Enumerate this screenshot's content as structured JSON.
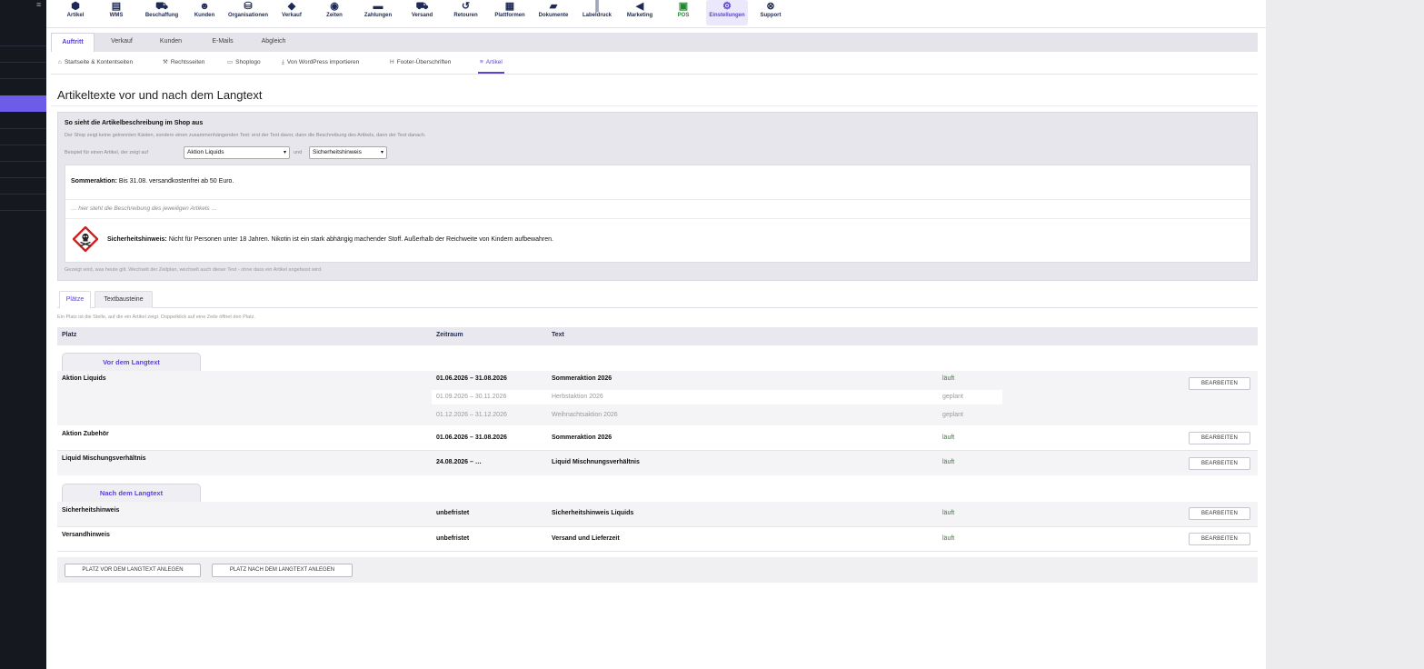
{
  "nav": [
    {
      "label": "Artikel",
      "icon": "cube-icon",
      "glyph": "⬢"
    },
    {
      "label": "WMS",
      "icon": "warehouse-icon",
      "glyph": "▤"
    },
    {
      "label": "Beschaffung",
      "icon": "cart-icon",
      "glyph": "⛟"
    },
    {
      "label": "Kunden",
      "icon": "users-icon",
      "glyph": "☻"
    },
    {
      "label": "Organisationen",
      "icon": "sitemap-icon",
      "glyph": "⛁"
    },
    {
      "label": "Verkauf",
      "icon": "tag-icon",
      "glyph": "◆"
    },
    {
      "label": "Zeiten",
      "icon": "stopwatch-icon",
      "glyph": "◉"
    },
    {
      "label": "Zahlungen",
      "icon": "money-icon",
      "glyph": "▬"
    },
    {
      "label": "Versand",
      "icon": "truck-icon",
      "glyph": "⛟"
    },
    {
      "label": "Retouren",
      "icon": "undo-icon",
      "glyph": "↺"
    },
    {
      "label": "Plattformen",
      "icon": "grid-icon",
      "glyph": "▦"
    },
    {
      "label": "Dokumente",
      "icon": "folder-icon",
      "glyph": "▰"
    },
    {
      "label": "Labeldruck",
      "icon": "barcode-icon",
      "glyph": "║"
    },
    {
      "label": "Marketing",
      "icon": "bullhorn-icon",
      "glyph": "◀"
    },
    {
      "label": "POS",
      "icon": "cash-register-icon",
      "glyph": "▣"
    },
    {
      "label": "Einstellungen",
      "icon": "gear-icon",
      "glyph": "⚙"
    },
    {
      "label": "Support",
      "icon": "lifebuoy-icon",
      "glyph": "⊗"
    }
  ],
  "tabs": [
    "Auftritt",
    "Verkauf",
    "Kunden",
    "E-Mails",
    "Abgleich"
  ],
  "subnav": [
    {
      "label": "Startseite & Kontentseiten",
      "glyph": "⌂",
      "icon": "home-icon"
    },
    {
      "label": "Rechtsseiten",
      "glyph": "⚒",
      "icon": "gavel-icon"
    },
    {
      "label": "Shoplogo",
      "glyph": "▭",
      "icon": "image-icon"
    },
    {
      "label": "Von WordPress importieren",
      "glyph": "⤓",
      "icon": "download-icon"
    },
    {
      "label": "Footer-Überschriften",
      "glyph": "H",
      "icon": "heading-icon"
    },
    {
      "label": "Artikel",
      "glyph": "≡",
      "icon": "list-icon"
    }
  ],
  "page_title": "Artikeltexte vor und nach dem Langtext",
  "preview": {
    "heading": "So sieht die Artikelbeschreibung im Shop aus",
    "description": "Der Shop zeigt keine getrennten Kästen, sondern einen zusammenhängenden Text: erst der Text davor, dann die Beschreibung des Artikels, dann der Text danach.",
    "example_label": "Beispiel für einen Artikel, der zeigt auf",
    "select1": "Aktion Liquids",
    "und": "und",
    "select2": "Sicherheitshinweis",
    "line1_bold": "Sommeraktion:",
    "line1_text": " Bis 31.08. versandkostenfrei ab 50 Euro.",
    "line2": "… hier steht die Beschreibung des jeweiligen Artikels …",
    "line3_bold": "Sicherheitshinweis:",
    "line3_text": " Nicht für Personen unter 18 Jahren. Nikotin ist ein stark abhängig machender Stoff. Außerhalb der Reichweite von Kindern aufbewahren.",
    "note": "Gezeigt wird, was heute gilt. Wechselt der Zeitplan, wechselt auch dieser Text - ohne dass ein Artikel angefasst wird."
  },
  "tabs2": [
    "Plätze",
    "Textbausteine"
  ],
  "hint": "Ein Platz ist die Stelle, auf die ein Artikel zeigt. Doppelklick auf eine Zeile öffnet den Platz.",
  "table": {
    "headers": {
      "platz": "Platz",
      "zeitraum": "Zeitraum",
      "text": "Text"
    },
    "group_before": "Vor dem Langtext",
    "group_after": "Nach dem Langtext",
    "edit_label": "BEARBEITEN",
    "rows": [
      {
        "name": "Aktion Liquids",
        "zeit": "01.06.2026 – 31.08.2026",
        "text": "Sommeraktion 2026",
        "status": "läuft"
      },
      {
        "name": "",
        "zeit": "01.09.2026 – 30.11.2026",
        "text": "Herbstaktion 2026",
        "status": "geplant"
      },
      {
        "name": "",
        "zeit": "01.12.2026 – 31.12.2026",
        "text": "Weihnachtsaktion 2026",
        "status": "geplant"
      },
      {
        "name": "Aktion Zubehör",
        "zeit": "01.06.2026 – 31.08.2026",
        "text": "Sommeraktion 2026",
        "status": "läuft"
      },
      {
        "name": "Liquid Mischungsverhältnis",
        "zeit": "24.08.2026 – …",
        "text": "Liquid Mischnungsverhältnis",
        "status": "läuft"
      },
      {
        "name": "Sicherheitshinweis",
        "zeit": "unbefristet",
        "text": "Sicherheitshinweis Liquids",
        "status": "läuft"
      },
      {
        "name": "Versandhinweis",
        "zeit": "unbefristet",
        "text": "Versand und Lieferzeit",
        "status": "läuft"
      }
    ]
  },
  "buttons": {
    "add_before": "PLATZ VOR DEM LANGTEXT ANLEGEN",
    "add_after": "PLATZ NACH DEM LANGTEXT ANLEGEN"
  },
  "colors": {
    "accent": "#5a43d6",
    "status_running": "#2a8a2a",
    "pos_green": "#1e8a2e"
  }
}
